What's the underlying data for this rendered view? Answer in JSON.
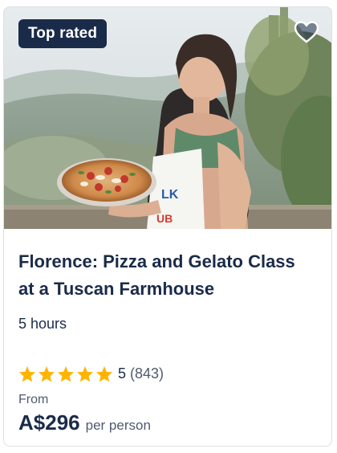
{
  "card": {
    "badge": "Top rated",
    "title": "Florence: Pizza and Gelato Class at a Tuscan Farmhouse",
    "duration": "5 hours",
    "rating": {
      "stars": 5,
      "score": "5",
      "count": "(843)"
    },
    "price": {
      "from_label": "From",
      "amount": "A$296",
      "unit": "per person"
    },
    "wishlist_icon": "heart-icon",
    "star_color": "#ffb400",
    "text_color": "#1a2b49"
  }
}
